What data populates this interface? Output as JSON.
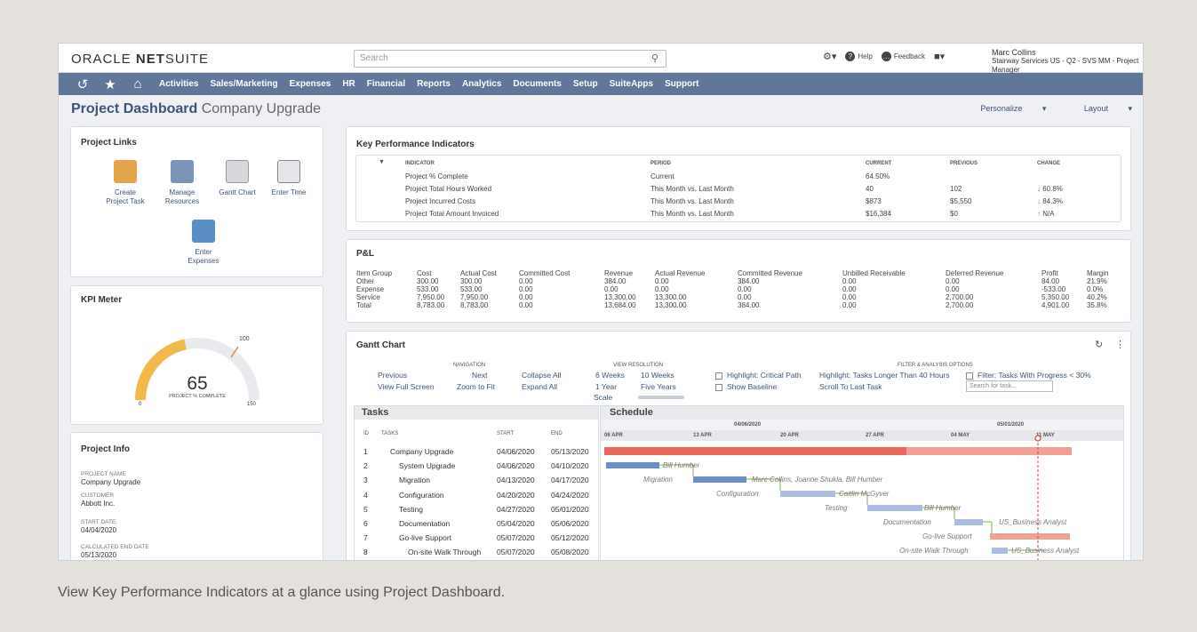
{
  "brand": {
    "oracle": "ORACLE",
    "net": "NET",
    "suite": "SUITE"
  },
  "search": {
    "placeholder": "Search"
  },
  "topright": {
    "help": "Help",
    "feedback": "Feedback",
    "user_name": "Marc Collins",
    "user_role": "Stairway Services US - Q2 - SVS MM - Project Manager"
  },
  "nav": {
    "items": [
      "Activities",
      "Sales/Marketing",
      "Expenses",
      "HR",
      "Financial",
      "Reports",
      "Analytics",
      "Documents",
      "Setup",
      "SuiteApps",
      "Support"
    ]
  },
  "header": {
    "title": "Project Dashboard",
    "subtitle": "Company Upgrade",
    "personalize": "Personalize",
    "layout": "Layout"
  },
  "project_links": {
    "title": "Project Links",
    "items": [
      {
        "line1": "Create",
        "line2": "Project Task"
      },
      {
        "line1": "Manage",
        "line2": "Resources"
      },
      {
        "line1": "Gantt Chart",
        "line2": ""
      },
      {
        "line1": "Enter Time",
        "line2": ""
      },
      {
        "line1": "Enter",
        "line2": "Expenses"
      }
    ]
  },
  "kpi_meter": {
    "title": "KPI Meter",
    "value": "65",
    "label": "PROJECT % COMPLETE",
    "min": "0",
    "max": "150",
    "mark": "100",
    "fraction": 0.433
  },
  "project_info": {
    "title": "Project Info",
    "fields": [
      {
        "label": "PROJECT NAME",
        "value": "Company Upgrade"
      },
      {
        "label": "CUSTOMER",
        "value": "Abbott Inc."
      },
      {
        "label": "START DATE",
        "value": "04/04/2020"
      },
      {
        "label": "CALCULATED END DATE",
        "value": "05/13/2020"
      }
    ]
  },
  "kpi": {
    "title": "Key Performance Indicators",
    "headers": [
      "INDICATOR",
      "PERIOD",
      "CURRENT",
      "PREVIOUS",
      "CHANGE"
    ],
    "rows": [
      {
        "indicator": "Project % Complete",
        "period": "Current",
        "current": "64.50%",
        "previous": "",
        "change": ""
      },
      {
        "indicator": "Project Total Hours Worked",
        "period": "This Month vs. Last Month",
        "current": "40",
        "previous": "102",
        "change": "60.8%",
        "dir": "down",
        "color": "#d64a3a"
      },
      {
        "indicator": "Project Incurred Costs",
        "period": "This Month vs. Last Month",
        "current": "$873",
        "previous": "$5,550",
        "change": "84.3%",
        "dir": "down",
        "color": "#5aa54a"
      },
      {
        "indicator": "Project Total Amount Invoiced",
        "period": "This Month vs. Last Month",
        "current": "$16,384",
        "previous": "$0",
        "change": "N/A",
        "dir": "up",
        "color": "#5aa54a"
      }
    ]
  },
  "pnl": {
    "title": "P&L",
    "headers": [
      "Item Group",
      "Cost",
      "Actual Cost",
      "Committed Cost",
      "Revenue",
      "Actual Revenue",
      "Committed Revenue",
      "Unbilled Receivable",
      "Deferred Revenue",
      "Profit",
      "Margin"
    ],
    "rows": [
      [
        "Other",
        "300.00",
        "300.00",
        "0.00",
        "384.00",
        "0.00",
        "384.00",
        "0.00",
        "0.00",
        "84.00",
        "21.9%"
      ],
      [
        "Expense",
        "533.00",
        "533.00",
        "0.00",
        "0.00",
        "0.00",
        "0.00",
        "0.00",
        "0.00",
        "-533.00",
        "0.0%"
      ],
      [
        "Service",
        "7,950.00",
        "7,950.00",
        "0.00",
        "13,300.00",
        "13,300.00",
        "0.00",
        "0.00",
        "2,700.00",
        "5,350.00",
        "40.2%"
      ],
      [
        "Total",
        "8,783.00",
        "8,783.00",
        "0.00",
        "13,684.00",
        "13,300.00",
        "384.00",
        "0.00",
        "2,700.00",
        "4,901.00",
        "35.8%"
      ]
    ]
  },
  "gantt": {
    "title": "Gantt Chart",
    "nav_header": "NAVIGATION",
    "res_header": "VIEW RESOLUTION",
    "filter_header": "FILTER & ANALYSIS OPTIONS",
    "previous": "Previous",
    "next": "Next",
    "collapse": "Collapse All",
    "full": "View Full Screen",
    "zoom": "Zoom to Fit",
    "expand": "Expand All",
    "w6": "6 Weeks",
    "w10": "10 Weeks",
    "y1": "1 Year",
    "y5": "Five Years",
    "scale": "Scale",
    "hl_critical": "Highlight: Critical Path",
    "hl_long": "Highlight: Tasks Longer Than 40 Hours",
    "filter_progress": "Filter: Tasks With Progress < 30%",
    "baseline": "Show Baseline",
    "scroll": "Scroll To Last Task",
    "search_ph": "Search for task...",
    "tasks_title": "Tasks",
    "schedule_title": "Schedule",
    "cols": [
      "ID",
      "TASKS",
      "START",
      "END"
    ],
    "tasks": [
      {
        "id": "1",
        "name": "Company Upgrade",
        "start": "04/06/2020",
        "end": "05/13/2020"
      },
      {
        "id": "2",
        "name": "System Upgrade",
        "start": "04/06/2020",
        "end": "04/10/2020"
      },
      {
        "id": "3",
        "name": "Migration",
        "start": "04/13/2020",
        "end": "04/17/2020"
      },
      {
        "id": "4",
        "name": "Configuration",
        "start": "04/20/2020",
        "end": "04/24/2020"
      },
      {
        "id": "5",
        "name": "Testing",
        "start": "04/27/2020",
        "end": "05/01/2020"
      },
      {
        "id": "6",
        "name": "Documentation",
        "start": "05/04/2020",
        "end": "05/06/2020"
      },
      {
        "id": "7",
        "name": "Go-live Support",
        "start": "05/07/2020",
        "end": "05/12/2020"
      },
      {
        "id": "8",
        "name": "On-site Walk Through",
        "start": "05/07/2020",
        "end": "05/08/2020"
      }
    ],
    "month1": "04/06/2020",
    "month2": "05/01/2020",
    "weeks": [
      "06 APR",
      "13 APR",
      "20 APR",
      "27 APR",
      "04 MAY",
      "11 MAY"
    ],
    "labels": {
      "bill1": "Bill Humber",
      "migration": "Migration",
      "marc": "Marc Collins, Joanne Shukla, Bill Humber",
      "config": "Configuration",
      "caitlin": "Caitlin McGyver",
      "testing": "Testing",
      "bill2": "Bill Humber",
      "doc": "Documentation",
      "ba1": "US_Business Analyst",
      "golive": "Go-live Support",
      "onsite": "On-site Walk Through",
      "ba2": "US_Business Analyst"
    }
  },
  "caption": "View Key Performance Indicators at a glance using Project Dashboard."
}
